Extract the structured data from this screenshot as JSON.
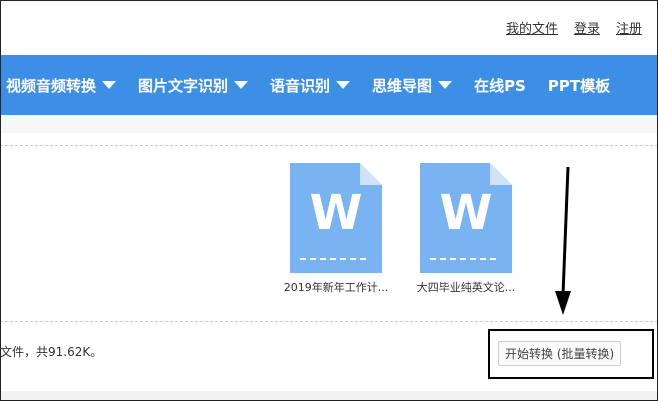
{
  "toplinks": {
    "my_files": "我的文件",
    "login": "登录",
    "register": "注册"
  },
  "nav": {
    "items": [
      {
        "label": "视频音频转换",
        "has_dropdown": true
      },
      {
        "label": "图片文字识别",
        "has_dropdown": true
      },
      {
        "label": "语音识别",
        "has_dropdown": true
      },
      {
        "label": "思维导图",
        "has_dropdown": true
      },
      {
        "label": "在线PS",
        "has_dropdown": false
      },
      {
        "label": "PPT模板",
        "has_dropdown": false
      }
    ],
    "color": "#3d8fe6"
  },
  "files": [
    {
      "name": "2019年新年工作计...",
      "icon": "word-document-icon",
      "letter": "W"
    },
    {
      "name": "大四毕业纯英文论...",
      "icon": "word-document-icon",
      "letter": "W"
    }
  ],
  "status": "文件，共91.62K。",
  "convert": {
    "label": "开始转换 (批量转换)"
  },
  "colors": {
    "file_icon": "#7ab3f2",
    "file_fold": "#cfe2f9"
  }
}
